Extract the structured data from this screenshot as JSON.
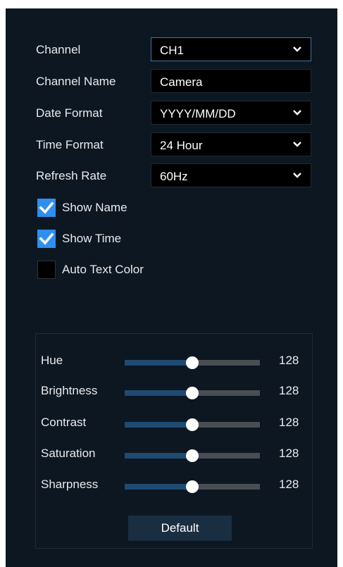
{
  "form": {
    "channel": {
      "label": "Channel",
      "value": "CH1"
    },
    "channel_name": {
      "label": "Channel Name",
      "value": "Camera"
    },
    "date_format": {
      "label": "Date Format",
      "value": "YYYY/MM/DD"
    },
    "time_format": {
      "label": "Time Format",
      "value": "24 Hour"
    },
    "refresh_rate": {
      "label": "Refresh Rate",
      "value": "60Hz"
    }
  },
  "checkboxes": {
    "show_name": {
      "label": "Show Name",
      "checked": true
    },
    "show_time": {
      "label": "Show Time",
      "checked": true
    },
    "auto_text_color": {
      "label": "Auto Text Color",
      "checked": false
    }
  },
  "image_adjust": {
    "hue": {
      "label": "Hue",
      "value": "128",
      "fraction": 0.5
    },
    "brightness": {
      "label": "Brightness",
      "value": "128",
      "fraction": 0.5
    },
    "contrast": {
      "label": "Contrast",
      "value": "128",
      "fraction": 0.5
    },
    "saturation": {
      "label": "Saturation",
      "value": "128",
      "fraction": 0.5
    },
    "sharpness": {
      "label": "Sharpness",
      "value": "128",
      "fraction": 0.5
    },
    "default_label": "Default"
  },
  "colors": {
    "panel_bg": "#0d1722",
    "checkbox_on": "#2f8ff0",
    "track_fill": "#1f4a72",
    "track_empty": "#4a4d52",
    "button_bg": "#1a2e42"
  },
  "icons": {
    "dropdown": "chevron-down-icon",
    "check": "checkmark-icon"
  }
}
